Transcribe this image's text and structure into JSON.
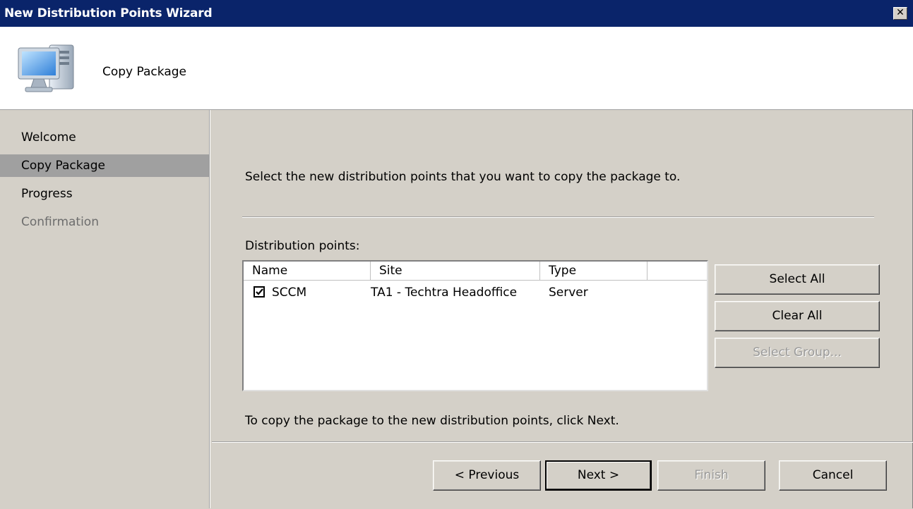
{
  "window": {
    "title": "New Distribution Points Wizard",
    "close_glyph": "✕"
  },
  "header": {
    "title": "Copy Package",
    "icon": "computer-icon"
  },
  "sidebar": {
    "items": [
      {
        "label": "Welcome",
        "state": "normal"
      },
      {
        "label": "Copy Package",
        "state": "active"
      },
      {
        "label": "Progress",
        "state": "normal"
      },
      {
        "label": "Confirmation",
        "state": "disabled"
      }
    ]
  },
  "main": {
    "instruction": "Select the new distribution points that you want to copy the package to.",
    "list_label": "Distribution points:",
    "columns": [
      "Name",
      "Site",
      "Type"
    ],
    "rows": [
      {
        "checked": true,
        "name": "SCCM",
        "site": "TA1 - Techtra Headoffice",
        "type": "Server"
      }
    ],
    "buttons": {
      "select_all": "Select All",
      "clear_all": "Clear All",
      "select_group": "Select Group..."
    },
    "footer_text": "To copy the package to the new distribution points, click Next."
  },
  "footer": {
    "previous": "< Previous",
    "next": "Next >",
    "finish": "Finish",
    "cancel": "Cancel"
  }
}
